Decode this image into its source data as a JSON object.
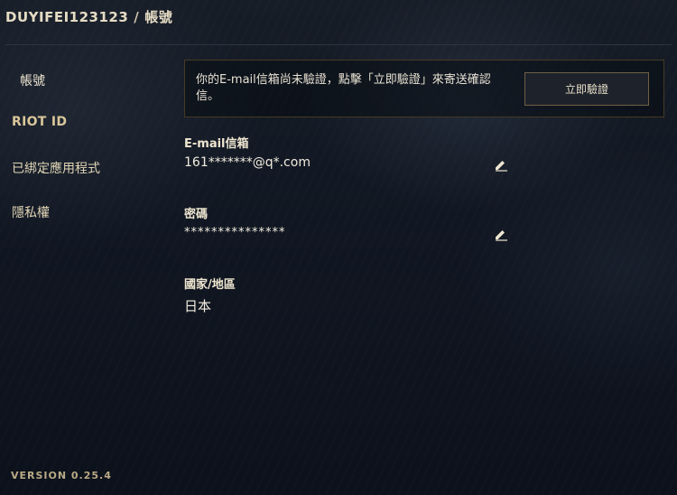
{
  "header": {
    "username": "DUYIFEI123123",
    "separator": "/",
    "section": "帳號"
  },
  "sidebar": {
    "items": [
      {
        "label": "帳號",
        "active": true
      },
      {
        "label": "RIOT ID",
        "active": false
      },
      {
        "label": "已綁定應用程式",
        "active": false
      },
      {
        "label": "隱私權",
        "active": false
      }
    ]
  },
  "notice": {
    "text": "你的E-mail信箱尚未驗證，點擊「立即驗證」來寄送確認信。",
    "button_label": "立即驗證"
  },
  "fields": {
    "email": {
      "label": "E-mail信箱",
      "value": "161*******@q*.com"
    },
    "password": {
      "label": "密碼",
      "value": "***************"
    },
    "region": {
      "label": "國家/地區",
      "value": "日本"
    }
  },
  "footer": {
    "version": "VERSION 0.25.4"
  },
  "icons": {
    "edit": "pencil-icon"
  },
  "colors": {
    "accent_gold": "#c8aa6e",
    "text_primary": "#f0e6d2",
    "background": "#111722"
  }
}
